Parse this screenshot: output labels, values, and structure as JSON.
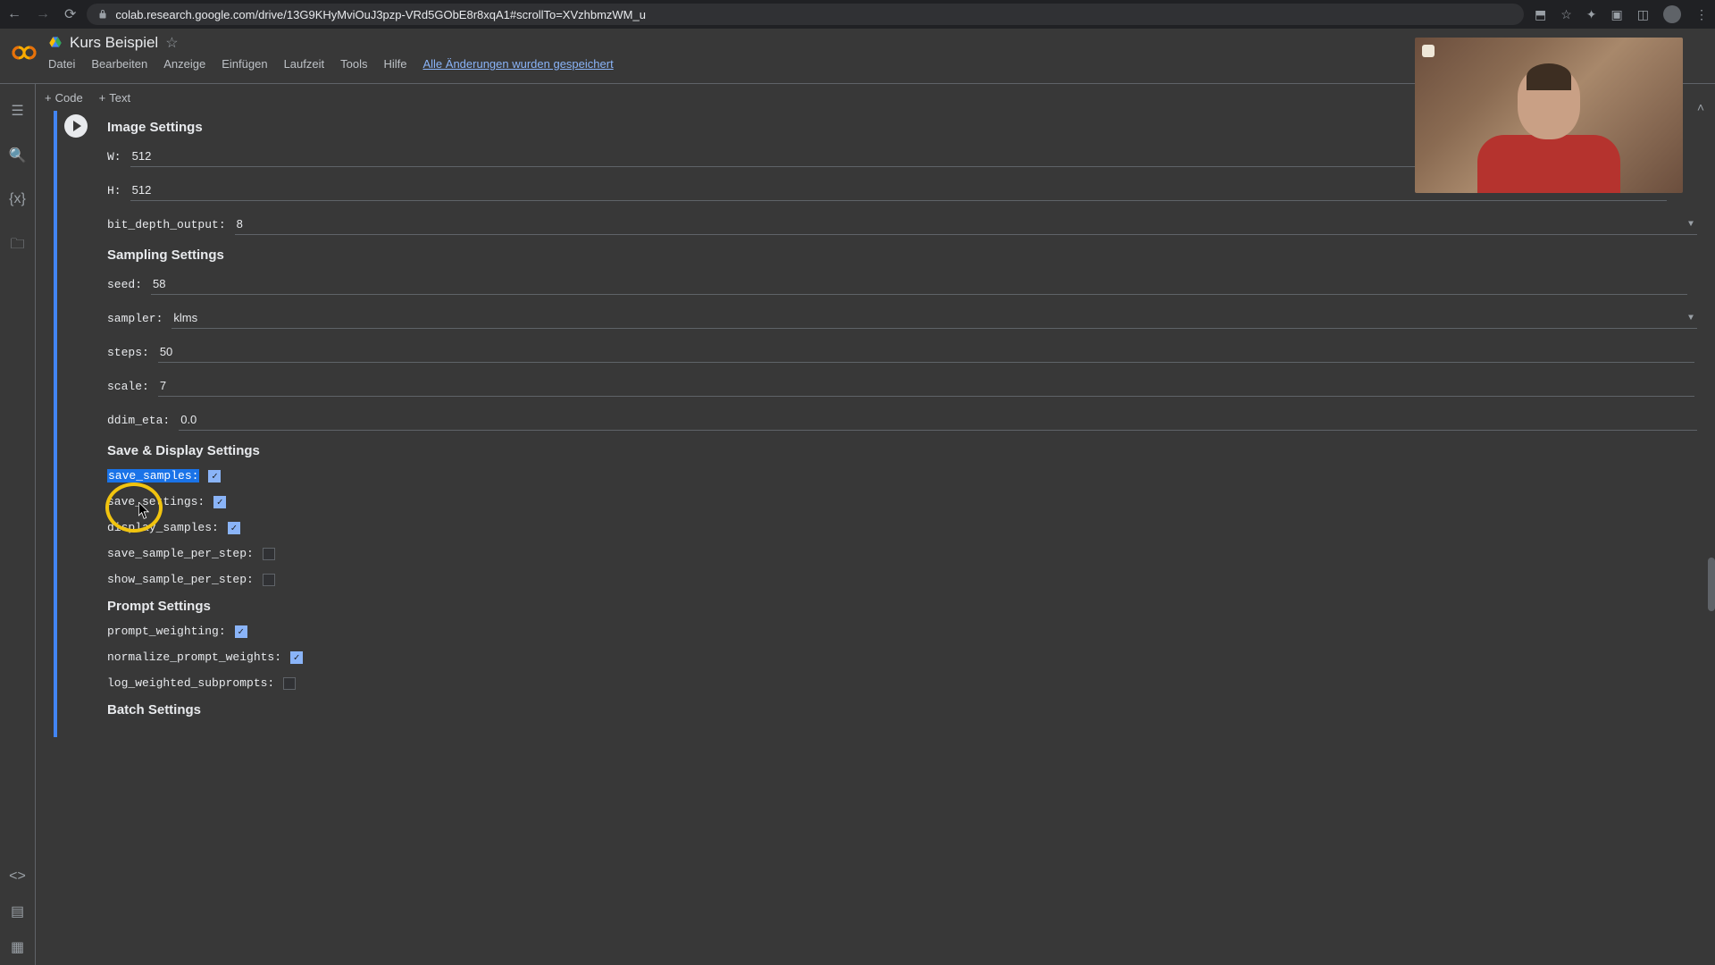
{
  "browser": {
    "url": "colab.research.google.com/drive/13G9KHyMviOuJ3pzp-VRd5GObE8r8xqA1#scrollTo=XVzhbmzWM_u"
  },
  "header": {
    "title": "Kurs Beispiel",
    "menu": [
      "Datei",
      "Bearbeiten",
      "Anzeige",
      "Einfügen",
      "Laufzeit",
      "Tools",
      "Hilfe"
    ],
    "save_status": "Alle Änderungen wurden gespeichert"
  },
  "toolbar": {
    "code": "Code",
    "text": "Text"
  },
  "sections": {
    "image": {
      "title": "Image Settings",
      "W_label": "W:",
      "W_value": "512",
      "H_label": "H:",
      "H_value": "512",
      "bit_label": "bit_depth_output:",
      "bit_value": "8"
    },
    "sampling": {
      "title": "Sampling Settings",
      "seed_label": "seed:",
      "seed_value": "58",
      "sampler_label": "sampler:",
      "sampler_value": "klms",
      "steps_label": "steps:",
      "steps_value": "50",
      "scale_label": "scale:",
      "scale_value": "7",
      "ddim_label": "ddim_eta:",
      "ddim_value": "0.0"
    },
    "save": {
      "title": "Save & Display Settings",
      "save_samples_label": "save_samples:",
      "save_settings_label": "save_settings:",
      "display_samples_label": "display_samples:",
      "save_per_step_label": "save_sample_per_step:",
      "show_per_step_label": "show_sample_per_step:"
    },
    "prompt": {
      "title": "Prompt Settings",
      "weighting_label": "prompt_weighting:",
      "normalize_label": "normalize_prompt_weights:",
      "log_label": "log_weighted_subprompts:"
    },
    "batch": {
      "title": "Batch Settings"
    }
  }
}
